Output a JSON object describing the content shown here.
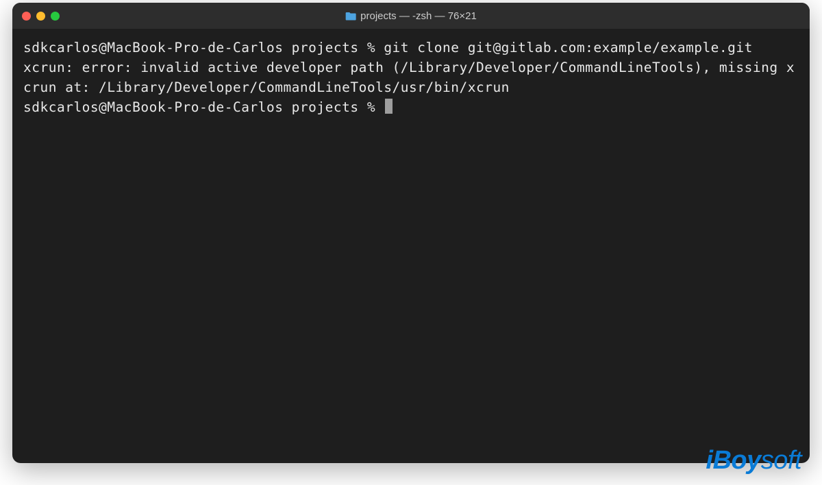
{
  "window": {
    "title": "projects — -zsh — 76×21"
  },
  "terminal": {
    "line1": "sdkcarlos@MacBook-Pro-de-Carlos projects % git clone git@gitlab.com:example/example.git",
    "line2": "xcrun: error: invalid active developer path (/Library/Developer/CommandLineTools), missing xcrun at: /Library/Developer/CommandLineTools/usr/bin/xcrun",
    "prompt2": "sdkcarlos@MacBook-Pro-de-Carlos projects % "
  },
  "watermark": {
    "brand_prefix": "iBoy",
    "brand_suffix": "soft"
  }
}
